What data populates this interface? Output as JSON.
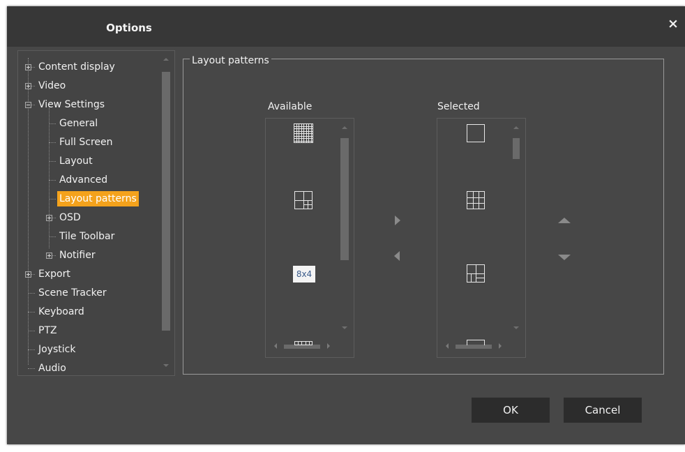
{
  "window": {
    "title": "Options",
    "close_glyph": "×",
    "close_icon": "close-icon"
  },
  "tree": {
    "items": [
      {
        "label": "Content display",
        "expander": "plus"
      },
      {
        "label": "Video",
        "expander": "plus"
      },
      {
        "label": "View Settings",
        "expander": "minus"
      },
      {
        "label": "General"
      },
      {
        "label": "Full Screen"
      },
      {
        "label": "Layout"
      },
      {
        "label": "Advanced"
      },
      {
        "label": "Layout patterns",
        "selected": true
      },
      {
        "label": "OSD",
        "expander": "plus"
      },
      {
        "label": "Tile Toolbar"
      },
      {
        "label": "Notifier",
        "expander": "plus"
      },
      {
        "label": "Export",
        "expander": "plus"
      },
      {
        "label": "Scene Tracker"
      },
      {
        "label": "Keyboard"
      },
      {
        "label": "PTZ"
      },
      {
        "label": "Joystick"
      },
      {
        "label": "Audio"
      }
    ]
  },
  "layout_patterns": {
    "group_label": "Layout patterns",
    "available": {
      "label": "Available",
      "items": [
        {
          "icon": "grid-8x8-layout-icon"
        },
        {
          "icon": "grid-4-with-sub-layout-icon"
        },
        {
          "icon": "grid-8x4-layout-icon",
          "text": "8x4"
        },
        {
          "icon": "grid-strip-layout-icon"
        }
      ]
    },
    "selected": {
      "label": "Selected",
      "items": [
        {
          "icon": "single-layout-icon"
        },
        {
          "icon": "grid-3x3-layout-icon"
        },
        {
          "icon": "grid-1-plus-sub-layout-icon"
        },
        {
          "icon": "partial-layout-icon"
        }
      ]
    },
    "move_right_icon": "arrow-right-icon",
    "move_left_icon": "arrow-left-icon",
    "move_up_icon": "arrow-up-icon",
    "move_down_icon": "arrow-down-icon"
  },
  "buttons": {
    "ok": "OK",
    "cancel": "Cancel"
  },
  "colors": {
    "dialog_bg": "#474747",
    "titlebar_bg": "#373737",
    "selected_item": "#f4a21c",
    "button_bg": "#2c2c2c"
  }
}
